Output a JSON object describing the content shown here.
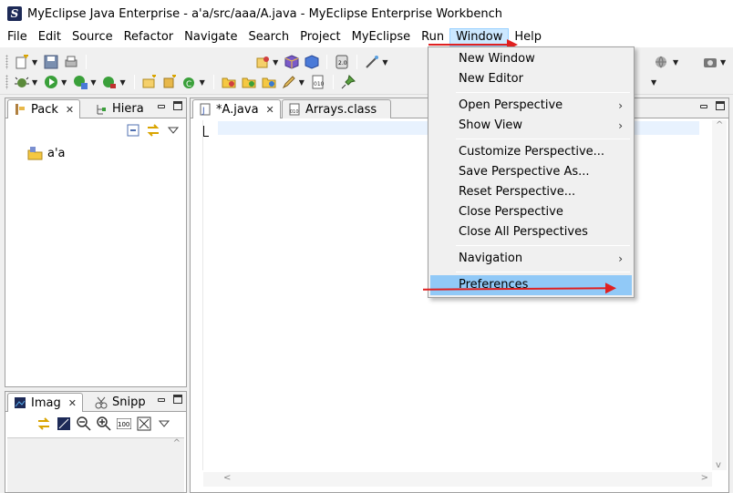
{
  "window": {
    "title": "MyEclipse Java Enterprise - a'a/src/aaa/A.java - MyEclipse Enterprise Workbench"
  },
  "menubar": {
    "items": [
      "File",
      "Edit",
      "Source",
      "Refactor",
      "Navigate",
      "Search",
      "Project",
      "MyEclipse",
      "Run",
      "Window",
      "Help"
    ],
    "active": "Window"
  },
  "left_panel": {
    "tabs": [
      {
        "label": "Pack",
        "icon": "package-explorer-icon",
        "selected": true,
        "closable": true
      },
      {
        "label": "Hiera",
        "icon": "hierarchy-icon",
        "selected": false
      }
    ],
    "tree": [
      {
        "label": "a'a",
        "icon": "java-project-icon"
      }
    ]
  },
  "bottom_left_panel": {
    "tabs": [
      {
        "label": "Imag",
        "icon": "image-viewer-icon",
        "selected": true,
        "closable": true
      },
      {
        "label": "Snipp",
        "icon": "snippets-icon",
        "selected": false
      }
    ]
  },
  "editor": {
    "tabs": [
      {
        "label": "*A.java",
        "icon": "java-file-icon",
        "selected": true,
        "closable": true
      },
      {
        "label": "Arrays.class",
        "icon": "class-file-icon",
        "selected": false
      }
    ]
  },
  "window_menu": {
    "items": [
      {
        "label": "New Window",
        "submenu": false
      },
      {
        "label": "New Editor",
        "submenu": false
      },
      {
        "label": "Open Perspective",
        "submenu": true
      },
      {
        "label": "Show View",
        "submenu": true
      },
      {
        "label": "Customize Perspective...",
        "submenu": false
      },
      {
        "label": "Save Perspective As...",
        "submenu": false
      },
      {
        "label": "Reset Perspective...",
        "submenu": false
      },
      {
        "label": "Close Perspective",
        "submenu": false
      },
      {
        "label": "Close All Perspectives",
        "submenu": false
      },
      {
        "label": "Navigation",
        "submenu": true
      },
      {
        "label": "Preferences",
        "submenu": false,
        "highlighted": true
      }
    ],
    "submenu_glyph": "›",
    "close_glyph": "✕"
  },
  "colors": {
    "annotation_arrow": "#e02020",
    "menu_highlight": "#91c9f7",
    "active_menu_bg": "#cce8ff"
  }
}
